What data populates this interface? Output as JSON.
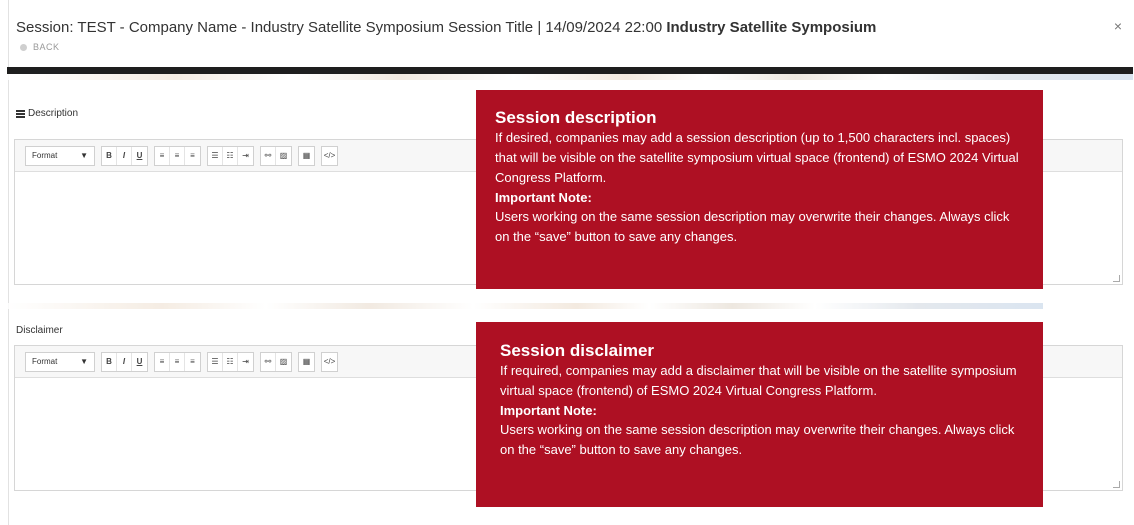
{
  "header": {
    "title_prefix": "Session: TEST - Company Name - Industry Satellite Symposium Session Title | 14/09/2024 22:00",
    "title_bold": "Industry Satellite Symposium",
    "back_label": "BACK",
    "close_glyph": "×"
  },
  "description": {
    "label": "Description",
    "toolbar": {
      "format_label": "Format",
      "format_caret": "▼",
      "bold": "B",
      "italic": "I",
      "underline": "U",
      "align_left": "≡",
      "align_center": "≡",
      "align_right": "≡",
      "bullet_list": "☰",
      "numbered_list": "☷",
      "indent": "⇥",
      "link": "⚯",
      "image": "▨",
      "table": "▦",
      "source": "</>"
    },
    "callout": {
      "title": "Session description",
      "body": "If desired, companies may add a session description (up to 1,500 characters incl. spaces) that will be visible on the satellite symposium virtual space (frontend) of ESMO 2024 Virtual Congress Platform.",
      "note_title": "Important Note:",
      "note_body": "Users working on the same session description may overwrite their changes. Always click on the “save” button to save any changes."
    }
  },
  "disclaimer": {
    "label": "Disclaimer",
    "toolbar": {
      "format_label": "Format",
      "format_caret": "▼",
      "bold": "B",
      "italic": "I",
      "underline": "U",
      "align_left": "≡",
      "align_center": "≡",
      "align_right": "≡",
      "bullet_list": "☰",
      "numbered_list": "☷",
      "indent": "⇥",
      "link": "⚯",
      "image": "▨",
      "table": "▦",
      "source": "</>"
    },
    "callout": {
      "title": "Session disclaimer",
      "body": "If required, companies may add a disclaimer that will be visible on the satellite symposium virtual space (frontend) of ESMO 2024 Virtual Congress Platform.",
      "note_title": "Important Note:",
      "note_body": "Users working on the same session description may overwrite their changes. Always click on the “save” button to save any changes."
    }
  },
  "colors": {
    "callout_bg": "#ae1023",
    "dark_bar": "#1e1e1e"
  }
}
